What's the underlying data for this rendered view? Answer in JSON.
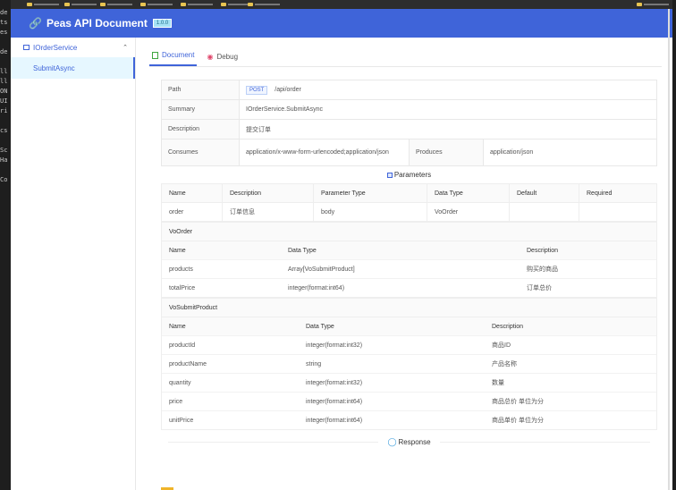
{
  "header": {
    "title": "Peas API Document",
    "version": "1.0.0"
  },
  "editor_strip": [
    "de",
    "ts",
    "es",
    "",
    "de",
    "",
    "ll",
    "ll",
    "ON",
    "UI",
    "ri",
    "",
    "cs",
    "",
    "Sc",
    "Ha",
    "",
    "Co"
  ],
  "sidebar": {
    "group_label": "IOrderService",
    "items": [
      {
        "label": "SubmitAsync"
      }
    ]
  },
  "tabs": [
    {
      "label": "Document"
    },
    {
      "label": "Debug"
    }
  ],
  "summary": {
    "path_key": "Path",
    "method": "POST",
    "path": "/api/order",
    "summary_key": "Summary",
    "summary_val": "IOrderService.SubmitAsync",
    "desc_key": "Description",
    "desc_val": "提交订单",
    "consumes_key": "Consumes",
    "consumes_val": "application/x-www-form-urlencoded;application/json",
    "produces_key": "Produces",
    "produces_val": "application/json"
  },
  "parameters": {
    "title": "Parameters",
    "headers": [
      "Name",
      "Description",
      "Parameter Type",
      "Data Type",
      "Default",
      "Required"
    ],
    "rows": [
      [
        "order",
        "订单信息",
        "body",
        "VoOrder",
        "",
        ""
      ]
    ]
  },
  "models": [
    {
      "title": "VoOrder",
      "headers": [
        "Name",
        "Data Type",
        "Description"
      ],
      "rows": [
        [
          "products",
          "Array[VoSubmitProduct]",
          "购买的商品"
        ],
        [
          "totalPrice",
          "integer(format:int64)",
          "订单总价"
        ]
      ]
    },
    {
      "title": "VoSubmitProduct",
      "headers": [
        "Name",
        "Data Type",
        "Description"
      ],
      "rows": [
        [
          "productId",
          "integer(format:int32)",
          "商品ID"
        ],
        [
          "productName",
          "string",
          "产品名称"
        ],
        [
          "quantity",
          "integer(format:int32)",
          "数量"
        ],
        [
          "price",
          "integer(format:int64)",
          "商品总价 单位为分"
        ],
        [
          "unitPrice",
          "integer(format:int64)",
          "商品单价 单位为分"
        ]
      ]
    }
  ],
  "response": {
    "title": "Response"
  },
  "colors": {
    "header_bg": "#3f64d9",
    "accent": "#3f64d9",
    "selected_bg": "#e6f7ff"
  }
}
